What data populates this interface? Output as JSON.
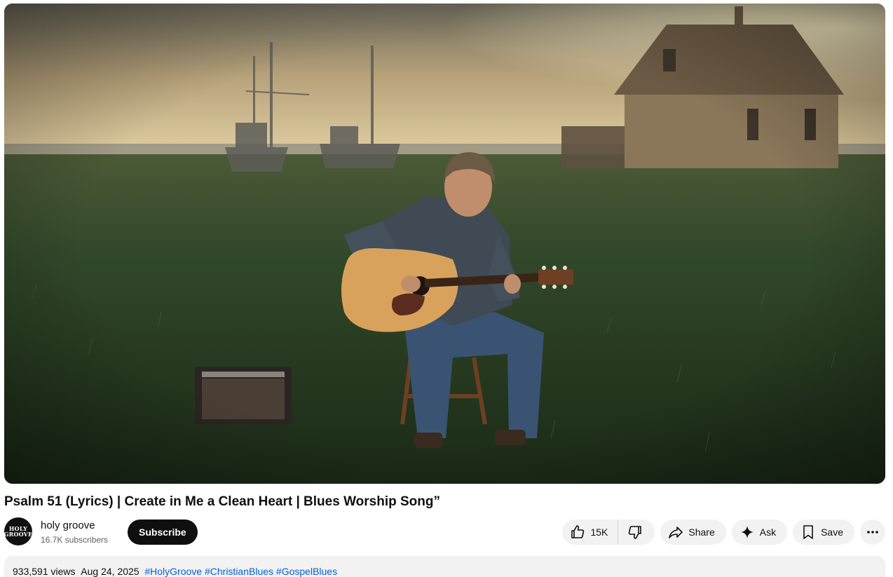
{
  "video": {
    "title": "Psalm 51 (Lyrics) | Create in Me a Clean Heart | Blues Worship Song”"
  },
  "channel": {
    "name": "holy groove",
    "subscribers": "16.7K subscribers",
    "avatar_text_top": "HOLY",
    "avatar_text_bottom": "GROOVE",
    "subscribe_label": "Subscribe"
  },
  "actions": {
    "like_count": "15K",
    "like_icon": "thumbs-up-icon",
    "dislike_icon": "thumbs-down-icon",
    "share_label": "Share",
    "share_icon": "share-arrow-icon",
    "ask_label": "Ask",
    "ask_icon": "sparkle-icon",
    "save_label": "Save",
    "save_icon": "bookmark-icon",
    "more_icon": "more-horizontal-icon"
  },
  "description": {
    "views": "933,591 views",
    "date": "Aug 24, 2025",
    "hashtags": [
      "#HolyGroove",
      "#ChristianBlues",
      "#GospelBlues"
    ]
  },
  "colors": {
    "link": "#065fd4",
    "pill_bg": "#f2f2f2",
    "subscribe_bg": "#0f0f0f"
  }
}
